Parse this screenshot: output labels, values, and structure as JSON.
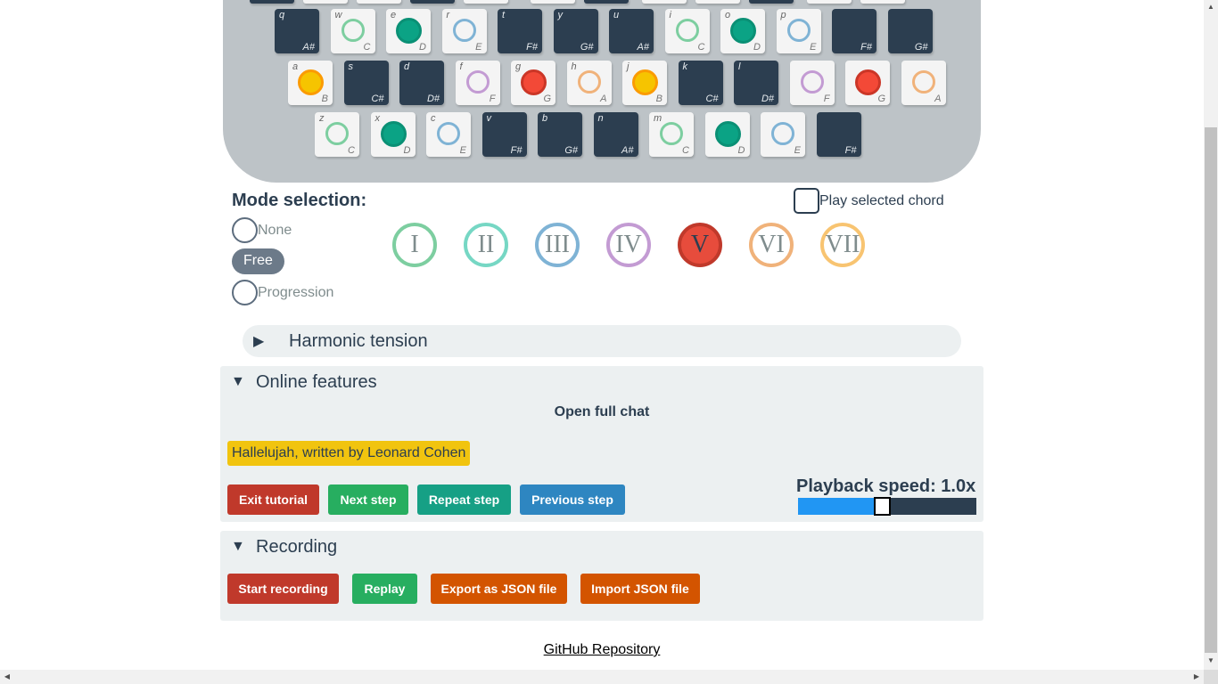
{
  "keyboard": {
    "rows": [
      {
        "offset": 0,
        "keys": [
          {
            "letter": "q",
            "note": "A#",
            "black": true,
            "marker": "none",
            "color": ""
          },
          {
            "letter": "w",
            "note": "C",
            "black": false,
            "marker": "ring",
            "color": "#7dcea0"
          },
          {
            "letter": "e",
            "note": "D",
            "black": false,
            "marker": "dot",
            "color": "#16a085"
          },
          {
            "letter": "r",
            "note": "E",
            "black": false,
            "marker": "ring",
            "color": "#7fb3d5"
          },
          {
            "letter": "t",
            "note": "F#",
            "black": true,
            "marker": "none",
            "color": ""
          },
          {
            "letter": "y",
            "note": "G#",
            "black": true,
            "marker": "none",
            "color": ""
          },
          {
            "letter": "u",
            "note": "A#",
            "black": true,
            "marker": "none",
            "color": ""
          },
          {
            "letter": "i",
            "note": "C",
            "black": false,
            "marker": "ring",
            "color": "#7dcea0"
          },
          {
            "letter": "o",
            "note": "D",
            "black": false,
            "marker": "dot",
            "color": "#16a085"
          },
          {
            "letter": "p",
            "note": "E",
            "black": false,
            "marker": "ring",
            "color": "#7fb3d5"
          },
          {
            "letter": "",
            "note": "F#",
            "black": true,
            "marker": "none",
            "color": ""
          },
          {
            "letter": "",
            "note": "G#",
            "black": true,
            "marker": "none",
            "color": ""
          }
        ]
      },
      {
        "offset": 1,
        "keys": [
          {
            "letter": "a",
            "note": "B",
            "black": false,
            "marker": "dot",
            "color": "#f1c40f"
          },
          {
            "letter": "s",
            "note": "C#",
            "black": true,
            "marker": "none",
            "color": ""
          },
          {
            "letter": "d",
            "note": "D#",
            "black": true,
            "marker": "none",
            "color": ""
          },
          {
            "letter": "f",
            "note": "F",
            "black": false,
            "marker": "ring",
            "color": "#c39bd3"
          },
          {
            "letter": "g",
            "note": "G",
            "black": false,
            "marker": "dot",
            "color": "#e74c3c"
          },
          {
            "letter": "h",
            "note": "A",
            "black": false,
            "marker": "ring",
            "color": "#f0b27a"
          },
          {
            "letter": "j",
            "note": "B",
            "black": false,
            "marker": "dot",
            "color": "#f1c40f"
          },
          {
            "letter": "k",
            "note": "C#",
            "black": true,
            "marker": "none",
            "color": ""
          },
          {
            "letter": "l",
            "note": "D#",
            "black": true,
            "marker": "none",
            "color": ""
          },
          {
            "letter": "",
            "note": "F",
            "black": false,
            "marker": "ring",
            "color": "#c39bd3"
          },
          {
            "letter": "",
            "note": "G",
            "black": false,
            "marker": "dot",
            "color": "#e74c3c"
          },
          {
            "letter": "",
            "note": "A",
            "black": false,
            "marker": "ring",
            "color": "#f0b27a"
          }
        ]
      },
      {
        "offset": 2,
        "keys": [
          {
            "letter": "z",
            "note": "C",
            "black": false,
            "marker": "ring",
            "color": "#7dcea0"
          },
          {
            "letter": "x",
            "note": "D",
            "black": false,
            "marker": "dot",
            "color": "#16a085"
          },
          {
            "letter": "c",
            "note": "E",
            "black": false,
            "marker": "ring",
            "color": "#7fb3d5"
          },
          {
            "letter": "v",
            "note": "F#",
            "black": true,
            "marker": "none",
            "color": ""
          },
          {
            "letter": "b",
            "note": "G#",
            "black": true,
            "marker": "none",
            "color": ""
          },
          {
            "letter": "n",
            "note": "A#",
            "black": true,
            "marker": "none",
            "color": ""
          },
          {
            "letter": "m",
            "note": "C",
            "black": false,
            "marker": "ring",
            "color": "#7dcea0"
          },
          {
            "letter": "",
            "note": "D",
            "black": false,
            "marker": "dot",
            "color": "#16a085"
          },
          {
            "letter": "",
            "note": "E",
            "black": false,
            "marker": "ring",
            "color": "#7fb3d5"
          },
          {
            "letter": "",
            "note": "F#",
            "black": true,
            "marker": "none",
            "color": ""
          }
        ]
      }
    ]
  },
  "mode": {
    "title": "Mode selection:",
    "options": {
      "none": "None",
      "free": "Free",
      "progression": "Progression"
    },
    "selected": "Free"
  },
  "play_chord": {
    "label": "Play selected chord",
    "checked": false
  },
  "degrees": [
    {
      "label": "I",
      "color": "#7dcea0",
      "active": false
    },
    {
      "label": "II",
      "color": "#76d7c4",
      "active": false
    },
    {
      "label": "III",
      "color": "#7fb3d5",
      "active": false
    },
    {
      "label": "IV",
      "color": "#c39bd3",
      "active": false
    },
    {
      "label": "V",
      "color": "#c0392b",
      "active": true
    },
    {
      "label": "VI",
      "color": "#f0b27a",
      "active": false
    },
    {
      "label": "VII",
      "color": "#f8c471",
      "active": false
    }
  ],
  "harmonic": {
    "title": "Harmonic tension",
    "expanded": false
  },
  "online": {
    "title": "Online features",
    "expanded": true,
    "open_chat": "Open full chat",
    "song": "Hallelujah, written by Leonard Cohen",
    "buttons": {
      "exit": "Exit tutorial",
      "next": "Next step",
      "repeat": "Repeat step",
      "previous": "Previous step"
    },
    "speed_label": "Playback speed: 1.0x",
    "speed_fraction": 0.47
  },
  "recording": {
    "title": "Recording",
    "expanded": true,
    "buttons": {
      "start": "Start recording",
      "replay": "Replay",
      "export": "Export as JSON file",
      "import": "Import JSON file"
    }
  },
  "footer": {
    "github": "GitHub Repository"
  },
  "colors": {
    "red": "#c0392b",
    "green": "#27ae60",
    "teal": "#16a085",
    "blue": "#2e86c1",
    "orange": "#d35400",
    "yellow": "#f1c40f",
    "slider_fill": "#2196f3"
  }
}
